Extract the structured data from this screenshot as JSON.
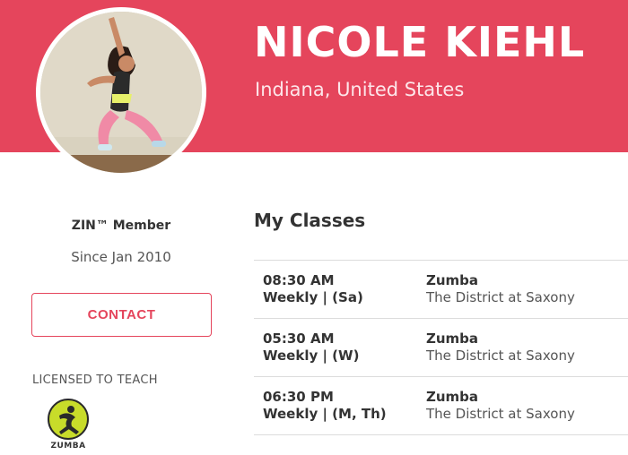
{
  "profile": {
    "name": "NICOLE KIEHL",
    "location": "Indiana, United States",
    "membership": "ZIN™ Member",
    "since": "Since Jan 2010",
    "contact_label": "CONTACT",
    "licensed_label": "LICENSED TO TEACH",
    "license_logo_label": "ZUMBA"
  },
  "colors": {
    "brand": "#e5455c",
    "logo_green": "#c8dc2a"
  },
  "classes": {
    "title": "My Classes",
    "items": [
      {
        "time": "08:30 AM",
        "frequency": "Weekly | (Sa)",
        "name": "Zumba",
        "venue": "The District at Saxony"
      },
      {
        "time": "05:30 AM",
        "frequency": "Weekly | (W)",
        "name": "Zumba",
        "venue": "The District at Saxony"
      },
      {
        "time": "06:30 PM",
        "frequency": "Weekly | (M, Th)",
        "name": "Zumba",
        "venue": "The District at Saxony"
      }
    ]
  }
}
